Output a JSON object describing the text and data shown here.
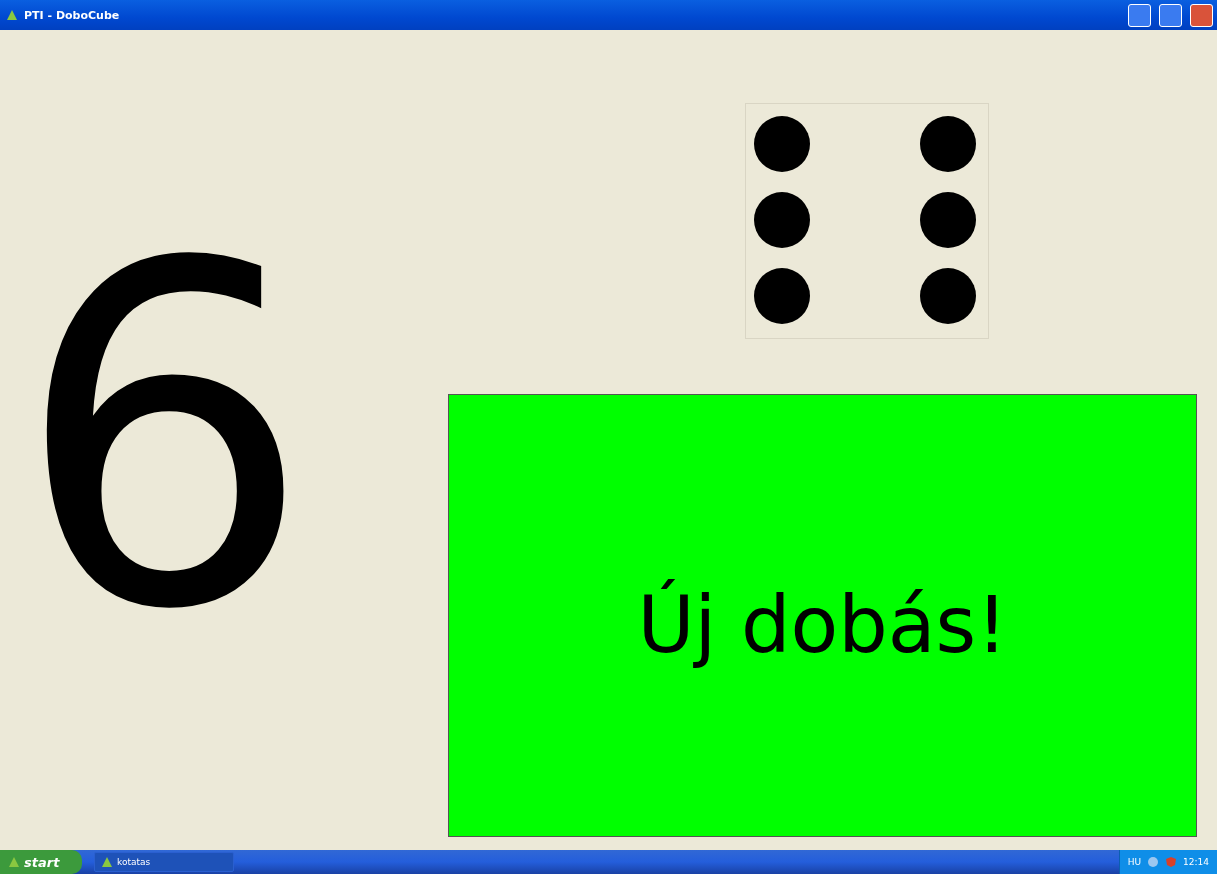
{
  "window": {
    "title": "PTI - DoboCube"
  },
  "result": {
    "value": "6"
  },
  "die": {
    "pips": [
      {
        "filled": true
      },
      {
        "filled": true
      },
      {
        "filled": true
      },
      {
        "filled": true
      },
      {
        "filled": true
      },
      {
        "filled": true
      }
    ]
  },
  "roll_button": {
    "label": "Új dobás!"
  },
  "taskbar": {
    "start": "start",
    "task": "kotatas",
    "language": "HU",
    "clock": "12:14"
  }
}
